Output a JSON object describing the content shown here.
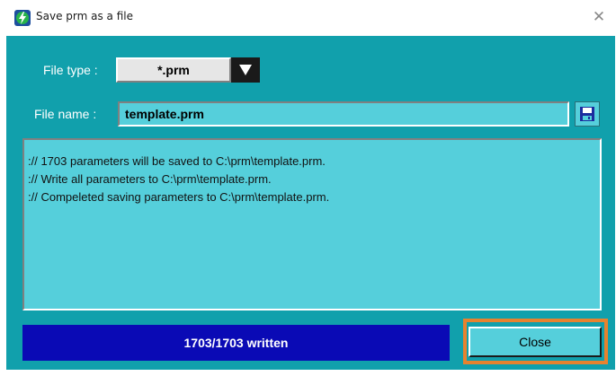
{
  "window": {
    "title": "Save prm as a file",
    "app_icon": "lightning-bolt-icon",
    "close_icon": "close-icon"
  },
  "form": {
    "file_type_label": "File type :",
    "file_type_value": "*.prm",
    "file_name_label": "File name :",
    "file_name_value": "template.prm",
    "save_icon": "floppy-disk-icon"
  },
  "log": {
    "lines": [
      ":// 1703 parameters will be saved to C:\\prm\\template.prm.",
      ":// Write all parameters to C:\\prm\\template.prm.",
      ":// Compeleted saving parameters to C:\\prm\\template.prm."
    ]
  },
  "progress": {
    "text": "1703/1703 written",
    "fraction": 1.0
  },
  "buttons": {
    "close_label": "Close"
  },
  "colors": {
    "client_bg": "#11a0ac",
    "field_bg": "#55cfdb",
    "progress_fill": "#0a0ab5",
    "highlight": "#e8822e"
  }
}
